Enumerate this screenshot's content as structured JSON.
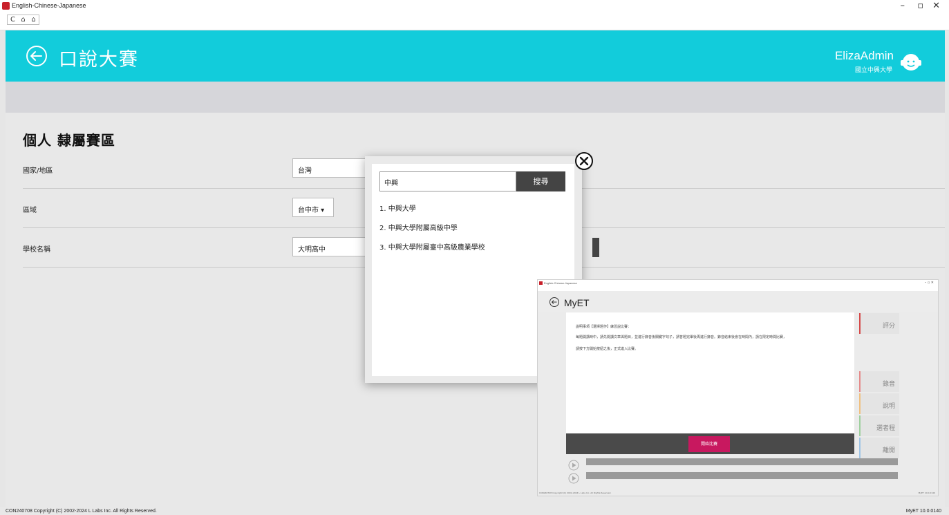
{
  "window": {
    "title": "English-Chinese-Japanese",
    "nav": [
      "C",
      "⌂",
      "⌂"
    ],
    "controls": [
      "–",
      "▫",
      "✕"
    ]
  },
  "header": {
    "title": "口說大賽",
    "user_name": "ElizaAdmin",
    "user_org": "國立中興大學"
  },
  "form": {
    "section_title": "個人 隸屬賽區",
    "rows": [
      {
        "label": "國家/地區",
        "value": "台灣"
      },
      {
        "label": "區域",
        "value": "台中市 ▾"
      },
      {
        "label": "學校名稱",
        "value": "大明高中"
      }
    ]
  },
  "modal": {
    "search_value": "中興",
    "search_button": "搜尋",
    "results": [
      "1. 中興大學",
      "2. 中興大學附屬高級中學",
      "3. 中興大學附屬臺中高級農業學校"
    ]
  },
  "thumbnail": {
    "title": "MyET",
    "window_title": "English-Chinese-Japanese",
    "lines": [
      "說明事項【選擇題作】練習說比賽：",
      "每題開講時中，請先閱讀文章與題目，並進行錄音後關鍵字句子，請答題完畢後再進行錄音。錄音結束後會在時間內，請在限定時間比賽，",
      "請按下方開始按鈕之後，正式進入比賽。"
    ],
    "start_button": "開始比賽",
    "side_buttons": [
      "評分",
      "錄音",
      "說明",
      "選者程",
      "離開"
    ],
    "footer_left": "CON240708 Copyright (C) 2002-2024 L Labs Inc. All Rights Reserved.",
    "footer_right": "MyET 10.0.0140"
  },
  "footer": {
    "copyright": "CON240708 Copyright (C) 2002-2024 L Labs Inc. All Rights Reserved.",
    "version": "MyET 10.0.0140"
  }
}
